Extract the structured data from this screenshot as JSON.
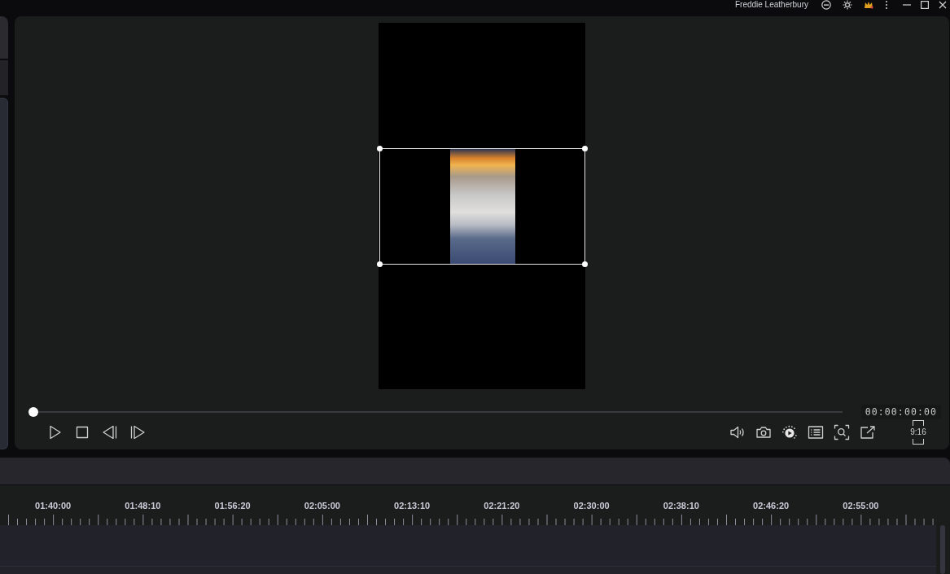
{
  "top_bar": {
    "user_name": "Freddie Leatherbury"
  },
  "preview": {
    "clip": {
      "selected": true
    },
    "seek": {
      "level": 0
    },
    "timecode": "00:00:00:00",
    "aspect_ratio": "9:16"
  },
  "timeline": {
    "ruler_labels": [
      "01:40:00",
      "01:48:10",
      "01:56:20",
      "02:05:00",
      "02:13:10",
      "02:21:20",
      "02:30:00",
      "02:38:10",
      "02:46:20",
      "02:55:00"
    ]
  }
}
